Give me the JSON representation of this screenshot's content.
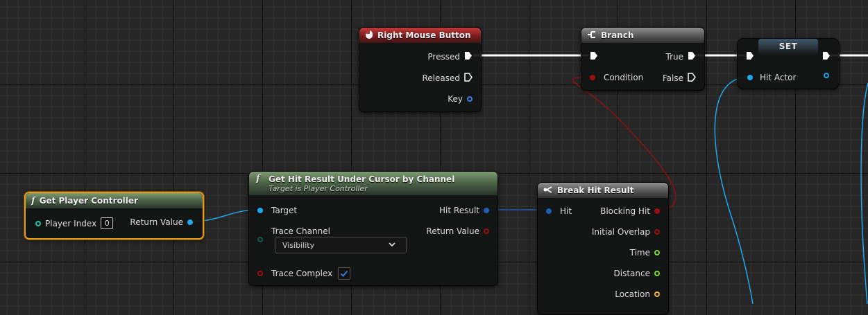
{
  "nodes": {
    "right_mouse": {
      "title": "Right Mouse Button",
      "pins": {
        "pressed": "Pressed",
        "released": "Released",
        "key": "Key"
      }
    },
    "branch": {
      "title": "Branch",
      "pins": {
        "condition": "Condition",
        "true": "True",
        "false": "False"
      }
    },
    "set": {
      "title": "SET",
      "pins": {
        "hit_actor": "Hit Actor"
      }
    },
    "get_player_controller": {
      "title": "Get Player Controller",
      "pins": {
        "player_index": "Player Index",
        "player_index_value": "0",
        "return_value": "Return Value"
      }
    },
    "get_hit_result": {
      "title": "Get Hit Result Under Cursor by Channel",
      "subtitle": "Target is Player Controller",
      "pins": {
        "target": "Target",
        "trace_channel": "Trace Channel",
        "trace_channel_value": "Visibility",
        "trace_complex": "Trace Complex",
        "hit_result": "Hit Result",
        "return_value": "Return Value"
      }
    },
    "break_hit_result": {
      "title": "Break Hit Result",
      "pins": {
        "hit": "Hit",
        "blocking_hit": "Blocking Hit",
        "initial_overlap": "Initial Overlap",
        "time": "Time",
        "distance": "Distance",
        "location": "Location"
      }
    }
  },
  "pin_colors": {
    "exec": "#ffffff",
    "object": "#1da8ee",
    "bool": "#9c0e0e",
    "float": "#7cdb2a",
    "vector": "#f0b626",
    "int": "#1fc4ab"
  },
  "icons": {
    "function": "function-icon",
    "mouse": "mouse-icon",
    "branch": "branch-icon",
    "break": "break-struct-icon"
  }
}
